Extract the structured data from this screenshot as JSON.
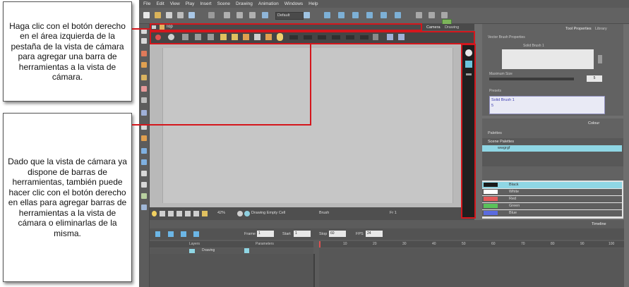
{
  "callouts": {
    "top": "Haga clic con el botón derecho en el área izquierda de la pestaña de la vista de cámara para agregar una barra de herramientas a la vista de cámara.",
    "bottom": "Dado que la vista de cámara ya dispone de barras de herramientas, también puede hacer clic con el botón derecho en ellas para agregar barras de herramientas a la vista de cámara o eliminarlas de la misma."
  },
  "menu": [
    "File",
    "Edit",
    "View",
    "Play",
    "Insert",
    "Scene",
    "Drawing",
    "Animation",
    "Windows",
    "Help"
  ],
  "toolbar": {
    "preset_select": "Default"
  },
  "camera_view": {
    "tab_label": "Top",
    "tabs": [
      "Camera",
      "Drawing"
    ],
    "status": {
      "zoom": "42%",
      "drawing": "Drawing Empty Cell",
      "tool": "Brush",
      "frame": "Fr 1"
    }
  },
  "tool_properties": {
    "tabs": [
      "Tool Properties",
      "Library"
    ],
    "section": "Vector Brush Properties",
    "brush_name": "Solid Brush 1",
    "max_size_label": "Maximum Size",
    "max_size_value": "5",
    "presets_label": "Presets",
    "preset_name": "Solid Brush 1",
    "preset_size": "5"
  },
  "colour": {
    "tab": "Colour",
    "palettes_label": "Palettes",
    "scene_palettes": "Scene Palettes",
    "palette_item": "wwgrgf",
    "swatches": [
      {
        "name": "Black",
        "color": "#1a1a1a"
      },
      {
        "name": "White",
        "color": "#ffffff"
      },
      {
        "name": "Red",
        "color": "#e35a5a"
      },
      {
        "name": "Green",
        "color": "#59c25a"
      },
      {
        "name": "Blue",
        "color": "#5a6be0"
      }
    ]
  },
  "timeline": {
    "tab": "Timeline",
    "frame_label": "Frame",
    "frame_value": "1",
    "start_label": "Start",
    "start_value": "1",
    "stop_label": "Stop",
    "stop_value": "60",
    "fps_label": "FPS",
    "fps_value": "24",
    "layers_label": "Layers",
    "params_label": "Parameters",
    "layer_name": "Drawing",
    "ruler": [
      "10",
      "20",
      "30",
      "40",
      "50",
      "60",
      "70",
      "80",
      "90",
      "100"
    ]
  }
}
